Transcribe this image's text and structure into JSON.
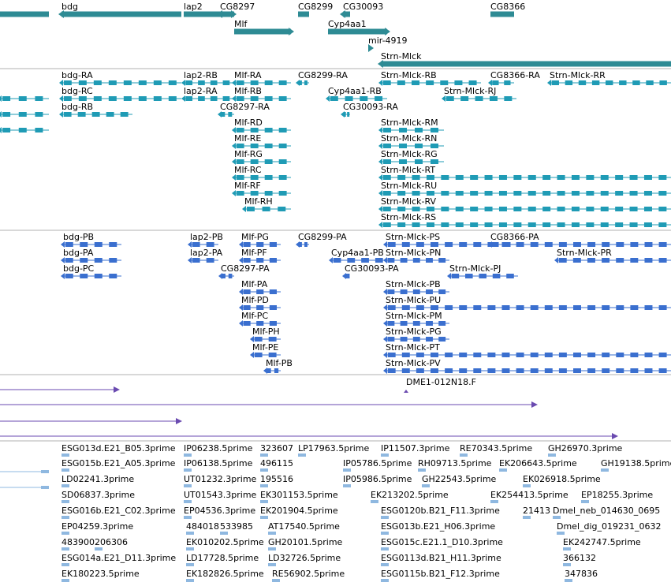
{
  "colors": {
    "gene": "#2e8b94",
    "transcript_A": "#1f9bb5",
    "transcript_B": "#3a6fcf",
    "insertion": "#6a4ab0",
    "est": "#8fb8e0",
    "divider": "#b0b0b0"
  },
  "tracks": [
    {
      "id": "genes",
      "color": "gene",
      "features": [
        {
          "label": "bdg",
          "start": 78,
          "end": 230,
          "arrow": "left",
          "bar": 7
        },
        {
          "label": "",
          "start": 0,
          "end": 62,
          "arrow": "none",
          "bar": 7
        },
        {
          "label": "lap2",
          "start": 233,
          "end": 296,
          "arrow": "right",
          "bar": 7
        },
        {
          "label": "CG8297",
          "start": 279,
          "end": 297,
          "arrow": "left",
          "bar": 7
        },
        {
          "label": "CG8299",
          "start": 378,
          "end": 392,
          "arrow": "none",
          "bar": 7
        },
        {
          "label": "CG30093",
          "start": 435,
          "end": 444,
          "arrow": "left",
          "bar": 7
        },
        {
          "label": "CG8366",
          "start": 622,
          "end": 652,
          "arrow": "none",
          "bar": 7
        },
        {
          "label": "Mlf",
          "start": 297,
          "end": 369,
          "arrow": "right",
          "bar": 7
        },
        {
          "label": "Cyp4aa1",
          "start": 416,
          "end": 491,
          "arrow": "right",
          "bar": 7
        },
        {
          "label": "mir-4919",
          "start": 467,
          "end": 470,
          "arrow": "right",
          "bar": 5
        },
        {
          "label": "Strn-Mlck",
          "start": 483,
          "end": 851,
          "arrow": "left",
          "bar": 7
        }
      ]
    },
    {
      "id": "transcripts-a",
      "color": "transcript_A",
      "features": [
        {
          "label": "bdg-RA",
          "start": 78,
          "end": 230
        },
        {
          "label": "bdg-RC",
          "start": 78,
          "end": 230
        },
        {
          "label": "bdg-RB",
          "start": 78,
          "end": 168
        },
        {
          "label": "",
          "start": 0,
          "end": 62
        },
        {
          "label": "",
          "start": 0,
          "end": 62
        },
        {
          "label": "",
          "start": 0,
          "end": 62
        },
        {
          "label": "lap2-RB",
          "start": 233,
          "end": 296
        },
        {
          "label": "lap2-RA",
          "start": 233,
          "end": 296
        },
        {
          "label": "CG8297-RA",
          "start": 279,
          "end": 297
        },
        {
          "label": "Mlf-RA",
          "start": 297,
          "end": 369
        },
        {
          "label": "Mlf-RB",
          "start": 297,
          "end": 369
        },
        {
          "label": "Mlf-RD",
          "start": 297,
          "end": 369
        },
        {
          "label": "Mlf-RE",
          "start": 297,
          "end": 369
        },
        {
          "label": "Mlf-RG",
          "start": 297,
          "end": 369
        },
        {
          "label": "Mlf-RC",
          "start": 297,
          "end": 369
        },
        {
          "label": "Mlf-RF",
          "start": 297,
          "end": 369
        },
        {
          "label": "Mlf-RH",
          "start": 310,
          "end": 369
        },
        {
          "label": "CG8299-RA",
          "start": 378,
          "end": 392
        },
        {
          "label": "Cyp4aa1-RB",
          "start": 416,
          "end": 491
        },
        {
          "label": "CG30093-RA",
          "start": 435,
          "end": 444
        },
        {
          "label": "Strn-Mlck-RB",
          "start": 483,
          "end": 610
        },
        {
          "label": "CG8366-RA",
          "start": 622,
          "end": 652
        },
        {
          "label": "Strn-Mlck-RR",
          "start": 697,
          "end": 851
        },
        {
          "label": "Strn-Mlck-RJ",
          "start": 563,
          "end": 655
        },
        {
          "label": "Strn-Mlck-RM",
          "start": 483,
          "end": 563
        },
        {
          "label": "Strn-Mlck-RN",
          "start": 483,
          "end": 563
        },
        {
          "label": "Strn-Mlck-RG",
          "start": 483,
          "end": 563
        },
        {
          "label": "Strn-Mlck-RT",
          "start": 483,
          "end": 851
        },
        {
          "label": "Strn-Mlck-RU",
          "start": 483,
          "end": 851
        },
        {
          "label": "Strn-Mlck-RV",
          "start": 483,
          "end": 851
        },
        {
          "label": "Strn-Mlck-RS",
          "start": 483,
          "end": 851
        }
      ]
    },
    {
      "id": "transcripts-b",
      "color": "transcript_B",
      "features": [
        {
          "label": "bdg-PB",
          "start": 80,
          "end": 154
        },
        {
          "label": "bdg-PA",
          "start": 80,
          "end": 154
        },
        {
          "label": "bdg-PC",
          "start": 80,
          "end": 154
        },
        {
          "label": "lap2-PB",
          "start": 241,
          "end": 277
        },
        {
          "label": "lap2-PA",
          "start": 241,
          "end": 277
        },
        {
          "label": "CG8297-PA",
          "start": 280,
          "end": 297
        },
        {
          "label": "Mlf-PG",
          "start": 306,
          "end": 356
        },
        {
          "label": "Mlf-PF",
          "start": 306,
          "end": 356
        },
        {
          "label": "Mlf-PA",
          "start": 306,
          "end": 356
        },
        {
          "label": "Mlf-PD",
          "start": 306,
          "end": 356
        },
        {
          "label": "Mlf-PC",
          "start": 306,
          "end": 356
        },
        {
          "label": "Mlf-PH",
          "start": 320,
          "end": 356
        },
        {
          "label": "Mlf-PE",
          "start": 320,
          "end": 356
        },
        {
          "label": "Mlf-PB",
          "start": 337,
          "end": 356
        },
        {
          "label": "CG8299-PA",
          "start": 378,
          "end": 392
        },
        {
          "label": "Cyp4aa1-PB",
          "start": 420,
          "end": 491
        },
        {
          "label": "CG30093-PA",
          "start": 437,
          "end": 443
        },
        {
          "label": "Strn-Mlck-PS",
          "start": 489,
          "end": 851
        },
        {
          "label": "Strn-Mlck-PN",
          "start": 489,
          "end": 570
        },
        {
          "label": "CG8366-PA",
          "start": 622,
          "end": 652
        },
        {
          "label": "Strn-Mlck-PR",
          "start": 706,
          "end": 851
        },
        {
          "label": "Strn-Mlck-PJ",
          "start": 570,
          "end": 657
        },
        {
          "label": "Strn-Mlck-PB",
          "start": 489,
          "end": 570
        },
        {
          "label": "Strn-Mlck-PU",
          "start": 489,
          "end": 851
        },
        {
          "label": "Strn-Mlck-PM",
          "start": 489,
          "end": 570
        },
        {
          "label": "Strn-Mlck-PG",
          "start": 489,
          "end": 570
        },
        {
          "label": "Strn-Mlck-PT",
          "start": 489,
          "end": 851
        },
        {
          "label": "Strn-Mlck-PV",
          "start": 489,
          "end": 851
        }
      ]
    },
    {
      "id": "insertions",
      "color": "insertion",
      "features": [
        {
          "label": "",
          "start": 0,
          "end": 150
        },
        {
          "label": "DME1-012N18.F",
          "start": 515,
          "end": 517
        },
        {
          "label": "",
          "start": 0,
          "end": 680
        },
        {
          "label": "",
          "start": 0,
          "end": 229
        },
        {
          "label": "",
          "start": 0,
          "end": 782
        }
      ]
    },
    {
      "id": "ests",
      "color": "est",
      "labels": [
        "ESG013d.E21_B05.3prime",
        "IP06238.5prime",
        "323607",
        "LP17963.5prime",
        "IP11507.3prime",
        "RE70343.5prime",
        "GH26970.3prime",
        "ESG015b.E21_A05.3prime",
        "IP06138.5prime",
        "496115",
        "IP05786.5prime",
        "RH09713.5prime",
        "EK206643.5prime",
        "GH19138.5prime",
        "LD02241.3prime",
        "UT01232.3prime",
        "195516",
        "IP05986.5prime",
        "GH22543.5prime",
        "EK026918.5prime",
        "SD06837.3prime",
        "UT01543.3prime",
        "EK301153.5prime",
        "EK213202.5prime",
        "EK254413.5prime",
        "EP18255.3prime",
        "ESG016b.E21_C02.3prime",
        "EP04536.3prime",
        "EK201904.5prime",
        "ESG0120b.B21_F11.3prime",
        "21413",
        "Dmel_neb_014630_0695",
        "EP04259.3prime",
        "484018",
        "533985",
        "AT17540.5prime",
        "ESG013b.E21_H06.3prime",
        "Dmel_dig_019231_0632",
        "483900",
        "206306",
        "EK010202.5prime",
        "GH20101.5prime",
        "ESG015c.E21.1_D10.3prime",
        "EK242747.5prime",
        "ESG014a.E21_D11.3prime",
        "LD17728.5prime",
        "LD32726.5prime",
        "ESG0113d.B21_H11.3prime",
        "366132",
        "EK180223.5prime",
        "EK182826.5prime",
        "RE56902.5prime",
        "ESG0115b.B21_F12.3prime",
        "347836"
      ]
    }
  ]
}
